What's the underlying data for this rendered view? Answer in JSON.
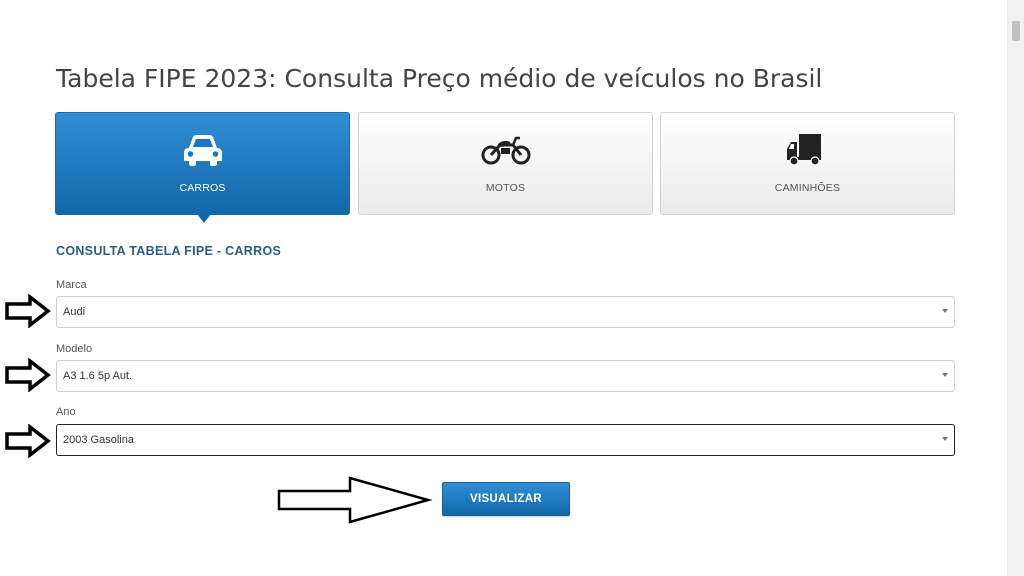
{
  "page": {
    "title": "Tabela FIPE 2023: Consulta Preço médio de veículos no Brasil"
  },
  "tabs": [
    {
      "label": "CARROS",
      "icon": "car-icon",
      "active": true
    },
    {
      "label": "MOTOS",
      "icon": "motorcycle-icon",
      "active": false
    },
    {
      "label": "CAMINHÕES",
      "icon": "truck-icon",
      "active": false
    }
  ],
  "form": {
    "section_title": "CONSULTA TABELA FIPE - CARROS",
    "fields": [
      {
        "label": "Marca",
        "value": "Audi"
      },
      {
        "label": "Modelo",
        "value": "A3 1.6 5p Aut."
      },
      {
        "label": "Ano",
        "value": "2003 Gasolina"
      }
    ],
    "submit_label": "VISUALIZAR"
  },
  "colors": {
    "accent": "#1a78c2",
    "section_title": "#2c5d86"
  }
}
